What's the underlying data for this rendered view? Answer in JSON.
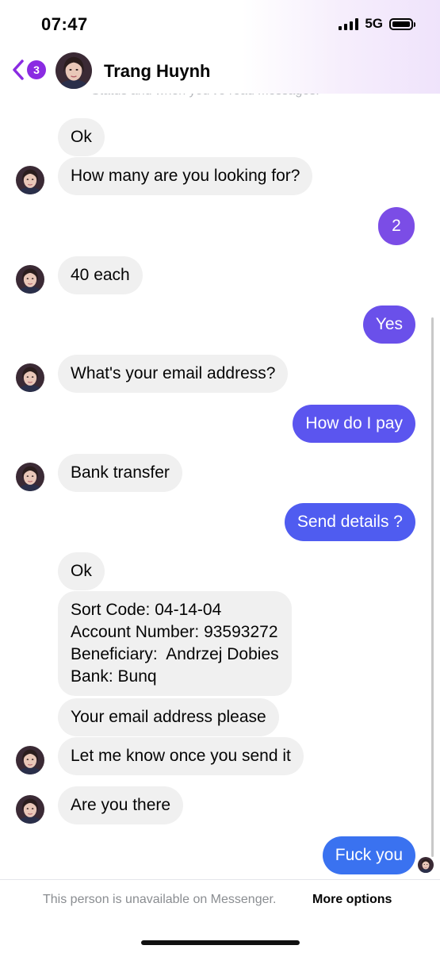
{
  "status_bar": {
    "time": "07:47",
    "network": "5G"
  },
  "header": {
    "back_badge": "3",
    "contact_name": "Trang Huynh"
  },
  "hidden_text": "Status and when you've read messages.",
  "messages": [
    {
      "text": "Ok"
    },
    {
      "text": "How many are you looking for?"
    },
    {
      "text": "2"
    },
    {
      "text": "40 each"
    },
    {
      "text": "Yes"
    },
    {
      "text": "What's your email address?"
    },
    {
      "text": "How do I pay"
    },
    {
      "text": "Bank transfer"
    },
    {
      "text": "Send details ?"
    },
    {
      "text": "Ok"
    },
    {
      "text": "Sort Code: 04-14-04\nAccount Number: 93593272\nBeneficiary:  Andrzej Dobies\nBank: Bunq"
    },
    {
      "text": "Your email address please"
    },
    {
      "text": "Let me know once you send it"
    },
    {
      "text": "Are you there"
    },
    {
      "text": "Fuck you"
    }
  ],
  "colors": {
    "outgoing_top": "#7b4de6",
    "outgoing_mid": "#5b55ef",
    "outgoing_bottom": "#3a72f0",
    "incoming": "#f0f0f0",
    "badge": "#8a2be2"
  },
  "footer": {
    "notice": "This person is unavailable on Messenger.",
    "link": "More options"
  }
}
